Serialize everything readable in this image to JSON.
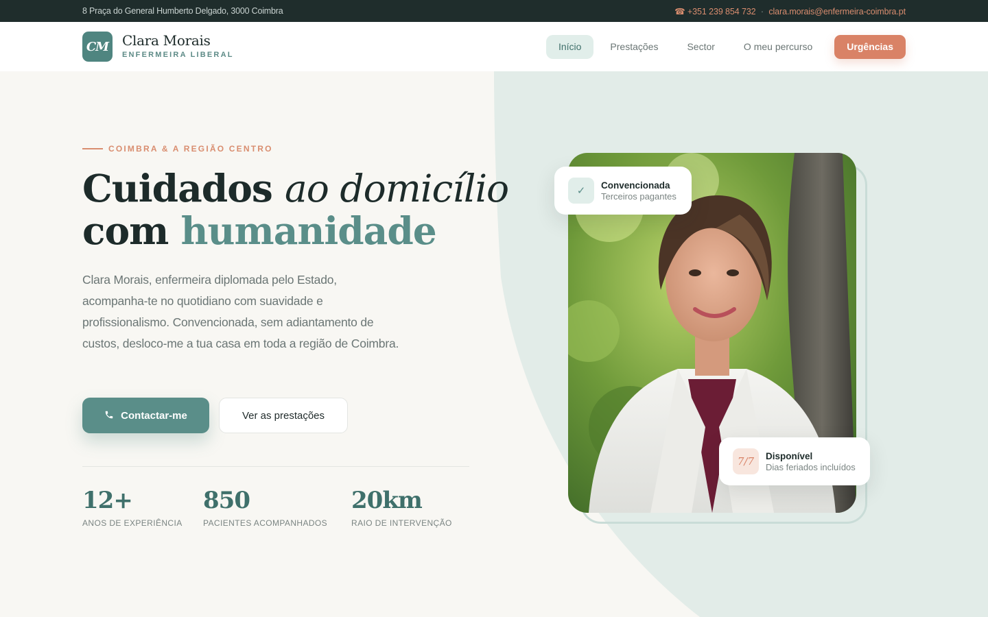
{
  "topbar": {
    "address": "8 Praça do General Humberto Delgado, 3000 Coimbra",
    "phone": "☎ +351 239 854 732",
    "separator": "·",
    "email": "clara.morais@enfermeira-coimbra.pt"
  },
  "brand": {
    "initials": "CM",
    "name": "Clara Morais",
    "subtitle": "ENFERMEIRA LIBERAL"
  },
  "nav": {
    "items": [
      {
        "label": "Início"
      },
      {
        "label": "Prestações"
      },
      {
        "label": "Sector"
      },
      {
        "label": "O meu percurso"
      }
    ],
    "cta": "Urgências"
  },
  "hero": {
    "eyebrow": "COIMBRA & A REGIÃO CENTRO",
    "headline": {
      "part1": "Cuidados ",
      "part2": "ao domicílio",
      "part3": "com ",
      "part4": "humanidade"
    },
    "lede": "Clara Morais, enfermeira diplomada pelo Estado, acompanha-te no quotidiano com suavidade e profissionalismo. Convencionada, sem adiantamento de custos, desloco-me a tua casa em toda a região de Coimbra.",
    "primary_button": "Contactar-me",
    "secondary_button": "Ver as prestações"
  },
  "stats": [
    {
      "value": "12+",
      "label": "ANOS DE EXPERIÊNCIA"
    },
    {
      "value": "850",
      "label": "PACIENTES ACOMPANHADOS"
    },
    {
      "value": "20km",
      "label": "RAIO DE INTERVENÇÃO"
    }
  ],
  "badges": {
    "top": {
      "icon": "✓",
      "title": "Convencionada",
      "subtitle": "Terceiros pagantes"
    },
    "bottom": {
      "icon": "7/7",
      "title": "Disponível",
      "subtitle": "Dias feriados incluídos"
    }
  },
  "colors": {
    "accent": "#5a8e89",
    "coral": "#d98266",
    "topbar": "#1f2d2c",
    "mint": "#e2ece8"
  }
}
